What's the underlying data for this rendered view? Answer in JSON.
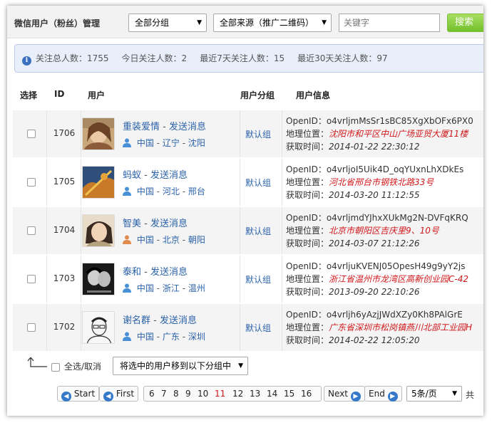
{
  "toolbar": {
    "title": "微信用户（粉丝）管理",
    "group_select": "全部分组",
    "source_select": "全部来源（推广二维码）",
    "keyword_placeholder": "关键字",
    "search_label": "搜索"
  },
  "stats": {
    "total": "关注总人数：1755",
    "today": "今日关注人数：2",
    "week": "最近7天关注人数：15",
    "month": "最近30天关注人数：97"
  },
  "table": {
    "headers": {
      "select": "选择",
      "id": "ID",
      "user": "用户",
      "group": "用户分组",
      "info": "用户信息"
    },
    "send_label": "发送消息",
    "rows": [
      {
        "id": "1706",
        "name": "重装爱情",
        "country": "中国",
        "province": "辽宁",
        "city": "沈阳",
        "gender": "male",
        "group": "默认组",
        "openid": "OpenID：o4vrljmMsSr1sBC85XgXbOFx6PX0",
        "location": "地理位置：沈阳市和平区中山广场亚贸大厦11楼",
        "time": "获取时间：2014-01-22 22:30:12"
      },
      {
        "id": "1705",
        "name": "蚂蚁",
        "country": "中国",
        "province": "河北",
        "city": "邢台",
        "gender": "male",
        "group": "默认组",
        "openid": "OpenID：o4vrljoI5Uik4D_oqYUxnLhXDkEs",
        "location": "地理位置：河北省邢台市钢铁北路33号",
        "time": "获取时间：2014-03-20 11:12:55"
      },
      {
        "id": "1704",
        "name": "智美",
        "country": "中国",
        "province": "北京",
        "city": "朝阳",
        "gender": "female",
        "group": "默认组",
        "openid": "OpenID：o4vrljmdYJhxXUkMg2N-DVFqKRQ",
        "location": "地理位置：北京市朝阳区吉庆里9、10号",
        "time": "获取时间：2014-03-07 21:12:26"
      },
      {
        "id": "1703",
        "name": "泰和",
        "country": "中国",
        "province": "浙江",
        "city": "温州",
        "gender": "male",
        "group": "默认组",
        "openid": "OpenID：o4vrljuKVENJ05OpesH49g9yY2js",
        "location": "地理位置：浙江省温州市龙湾区高新创业园C-42",
        "time": "获取时间：2013-09-20 22:10:26"
      },
      {
        "id": "1702",
        "name": "谢名群",
        "country": "中国",
        "province": "广东",
        "city": "深圳",
        "gender": "male",
        "group": "默认组",
        "openid": "OpenID：o4vrljh6yAzjJWdXZy0Kh8PAlGrE",
        "location": "地理位置：广东省深圳市松岗镇燕川北部工业园H",
        "time": "获取时间：2014-02-22 12:05:20"
      }
    ]
  },
  "bottom": {
    "select_all": "全选/取消",
    "move_select": "将选中的用户移到以下分组中"
  },
  "pager": {
    "start": "Start",
    "first": "First",
    "pages": [
      "6",
      "7",
      "8",
      "9",
      "10",
      "11",
      "12",
      "13",
      "14",
      "15",
      "16"
    ],
    "current": "11",
    "next": "Next",
    "end": "End",
    "per_page": "5条/页",
    "tail": "共"
  },
  "colors": {
    "link": "#2a62a9",
    "accent_red": "#d0191c",
    "search_green": "#72c02c",
    "pager_blue": "#3579c8"
  }
}
